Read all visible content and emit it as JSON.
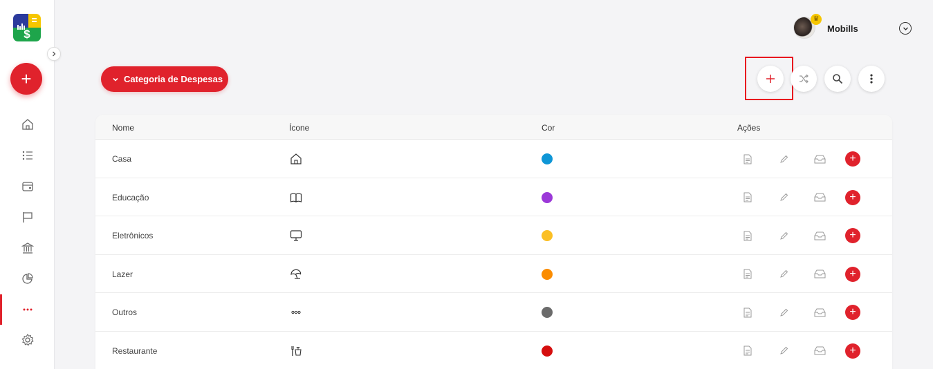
{
  "app": {
    "name": "Mobills"
  },
  "colors": {
    "accent": "#e0222c",
    "highlight": "#e8121f",
    "sidebar_active": "#e0222c"
  },
  "sidebar": {
    "logo": "mobills-logo",
    "fab_label": "+",
    "items": [
      {
        "icon": "home-icon"
      },
      {
        "icon": "list-icon"
      },
      {
        "icon": "wallet-icon"
      },
      {
        "icon": "flag-icon"
      },
      {
        "icon": "bank-icon"
      },
      {
        "icon": "pie-chart-icon"
      },
      {
        "icon": "more-icon",
        "active": true
      },
      {
        "icon": "gear-icon"
      }
    ]
  },
  "header": {
    "username": "Mobills",
    "dropdown_icon": "chevron-down-circle-icon"
  },
  "category_select": {
    "label": "Categoria de Despesas"
  },
  "toolbar": {
    "add_label": "+"
  },
  "table": {
    "columns": {
      "name": "Nome",
      "icon": "Ícone",
      "color": "Cor",
      "actions": "Ações"
    },
    "rows": [
      {
        "name": "Casa",
        "icon": "house-icon",
        "color": "#0e96d6"
      },
      {
        "name": "Educação",
        "icon": "book-icon",
        "color": "#9b38d8"
      },
      {
        "name": "Eletrônicos",
        "icon": "monitor-icon",
        "color": "#fbbf24"
      },
      {
        "name": "Lazer",
        "icon": "umbrella-icon",
        "color": "#fb8c00"
      },
      {
        "name": "Outros",
        "icon": "dots-icon",
        "color": "#6b6b6b"
      },
      {
        "name": "Restaurante",
        "icon": "food-icon",
        "color": "#d50e0e"
      }
    ],
    "add_sub_label": "+"
  }
}
